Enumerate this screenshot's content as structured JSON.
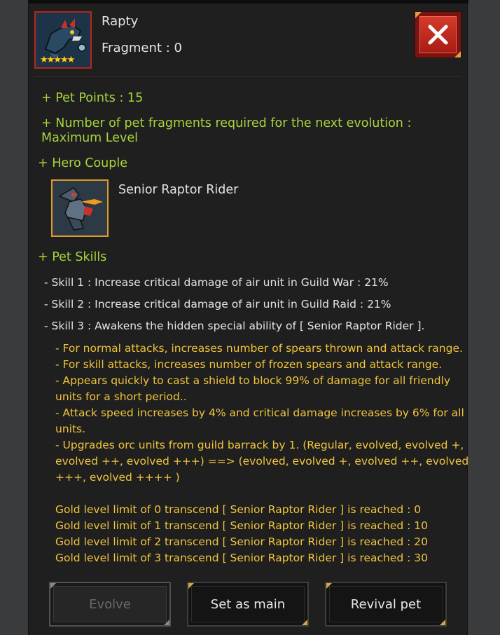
{
  "pet": {
    "name": "Rapty",
    "fragment": "Fragment : 0",
    "stars": "★★★★★"
  },
  "close_label": "✕",
  "info": {
    "pet_points": "+ Pet Points : 15",
    "fragments_required": "+ Number of pet fragments required for the next evolution :",
    "fragments_required_value": "Maximum Level",
    "hero_couple": "+ Hero Couple",
    "hero_name": "Senior Raptor Rider",
    "pet_skills": "+ Pet Skills"
  },
  "skills": [
    "- Skill 1 : Increase critical damage of air unit in Guild War : 21%",
    "- Skill 2 : Increase critical damage of air unit in Guild Raid : 21%",
    "- Skill 3 : Awakens the hidden special ability of [ Senior Raptor Rider ]."
  ],
  "effects": [
    "- For normal attacks, increases number of spears thrown and attack range.",
    "- For skill attacks, increases number of frozen spears and attack range.",
    "- Appears quickly to cast a shield to block 99% of damage for all friendly units for a short period..",
    "- Attack speed increases by 4% and critical damage increases by 6% for all units.",
    "- Upgrades orc units from guild barrack by 1. (Regular, evolved, evolved +, evolved ++, evolved +++) ==> (evolved, evolved +, evolved ++, evolved +++, evolved ++++ )"
  ],
  "limits": [
    "Gold level limit of 0 transcend [ Senior Raptor Rider ] is reached : 0",
    "Gold level limit of 1 transcend [ Senior Raptor Rider ] is reached : 10",
    "Gold level limit of 2 transcend [ Senior Raptor Rider ] is reached : 20",
    "Gold level limit of 3 transcend [ Senior Raptor Rider ] is reached : 30"
  ],
  "buttons": {
    "evolve": "Evolve",
    "set_main": "Set as main",
    "revival": "Revival pet"
  }
}
